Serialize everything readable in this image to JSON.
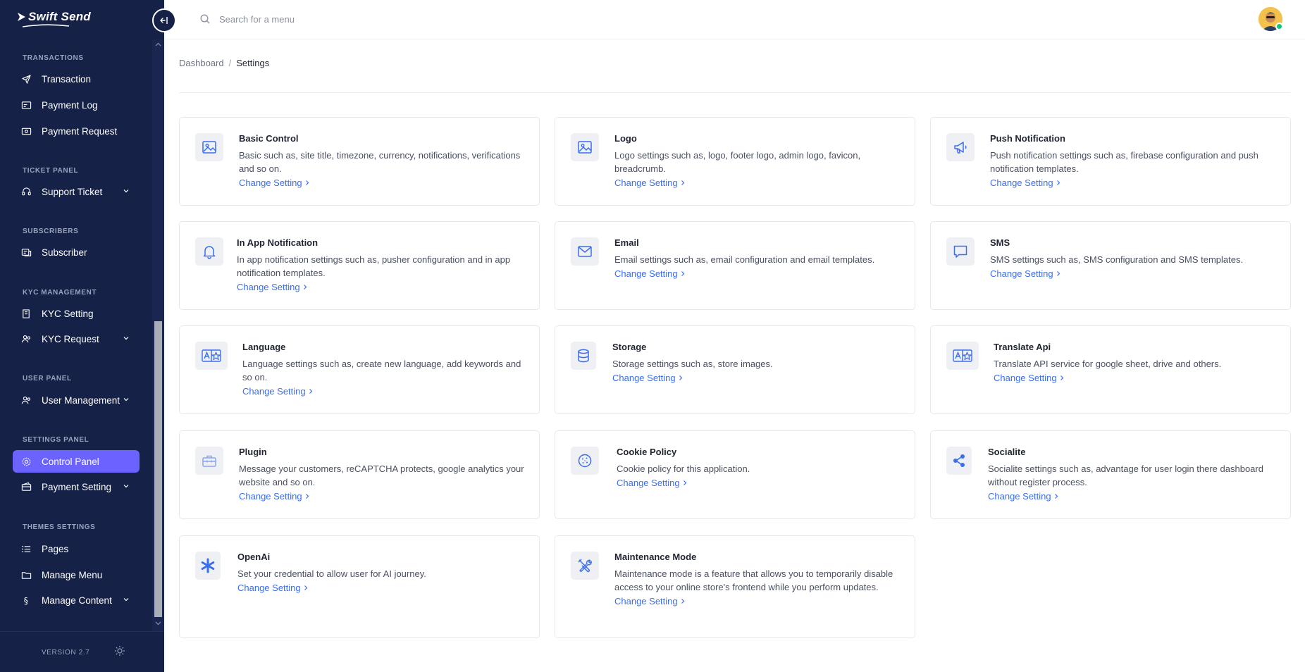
{
  "app": {
    "brand": "Swift Send",
    "version": "VERSION 2.7"
  },
  "search": {
    "placeholder": "Search for a menu"
  },
  "breadcrumb": {
    "root": "Dashboard",
    "separator": "/",
    "current": "Settings"
  },
  "sidebar": {
    "sections": [
      {
        "title": "TRANSACTIONS",
        "items": [
          {
            "label": "Transaction",
            "icon": "send-icon"
          },
          {
            "label": "Payment Log",
            "icon": "payment-log-icon"
          },
          {
            "label": "Payment Request",
            "icon": "cash-icon"
          }
        ]
      },
      {
        "title": "TICKET PANEL",
        "items": [
          {
            "label": "Support Ticket",
            "icon": "headset-icon",
            "expandable": true
          }
        ]
      },
      {
        "title": "SUBSCRIBERS",
        "items": [
          {
            "label": "Subscriber",
            "icon": "subscriber-icon"
          }
        ]
      },
      {
        "title": "KYC MANAGEMENT",
        "items": [
          {
            "label": "KYC Setting",
            "icon": "kyc-setting-icon"
          },
          {
            "label": "KYC Request",
            "icon": "users-icon",
            "expandable": true
          }
        ]
      },
      {
        "title": "USER PANEL",
        "items": [
          {
            "label": "User Management",
            "icon": "users-icon",
            "expandable": true
          }
        ]
      },
      {
        "title": "SETTINGS PANEL",
        "items": [
          {
            "label": "Control Panel",
            "icon": "gear-icon",
            "active": true
          },
          {
            "label": "Payment Setting",
            "icon": "payment-setting-icon",
            "expandable": true
          }
        ]
      },
      {
        "title": "THEMES SETTINGS",
        "items": [
          {
            "label": "Pages",
            "icon": "list-icon"
          },
          {
            "label": "Manage Menu",
            "icon": "folder-icon"
          },
          {
            "label": "Manage Content",
            "icon": "section-icon",
            "expandable": true
          }
        ]
      }
    ]
  },
  "cards": [
    {
      "title": "Basic Control",
      "desc": "Basic such as, site title, timezone, currency, notifications, verifications and so on.",
      "link": "Change Setting",
      "icon": "image-icon"
    },
    {
      "title": "Logo",
      "desc": "Logo settings such as, logo, footer logo, admin logo, favicon, breadcrumb.",
      "link": "Change Setting",
      "icon": "image-icon"
    },
    {
      "title": "Push Notification",
      "desc": "Push notification settings such as, firebase configuration and push notification templates.",
      "link": "Change Setting",
      "icon": "megaphone-icon"
    },
    {
      "title": "In App Notification",
      "desc": "In app notification settings such as, pusher configuration and in app notification templates.",
      "link": "Change Setting",
      "icon": "bell-icon"
    },
    {
      "title": "Email",
      "desc": "Email settings such as, email configuration and email templates.",
      "link": "Change Setting",
      "icon": "envelope-icon"
    },
    {
      "title": "SMS",
      "desc": "SMS settings such as, SMS configuration and SMS templates.",
      "link": "Change Setting",
      "icon": "chat-icon"
    },
    {
      "title": "Language",
      "desc": "Language settings such as, create new language, add keywords and so on.",
      "link": "Change Setting",
      "icon": "translate-icon"
    },
    {
      "title": "Storage",
      "desc": "Storage settings such as, store images.",
      "link": "Change Setting",
      "icon": "database-icon"
    },
    {
      "title": "Translate Api",
      "desc": "Translate API service for google sheet, drive and others.",
      "link": "Change Setting",
      "icon": "translate-icon"
    },
    {
      "title": "Plugin",
      "desc": "Message your customers, reCAPTCHA protects, google analytics your website and so on.",
      "link": "Change Setting",
      "icon": "toolbox-icon"
    },
    {
      "title": "Cookie Policy",
      "desc": "Cookie policy for this application.",
      "link": "Change Setting",
      "icon": "cookie-icon"
    },
    {
      "title": "Socialite",
      "desc": "Socialite settings such as, advantage for user login there dashboard without register process.",
      "link": "Change Setting",
      "icon": "share-icon"
    },
    {
      "title": "OpenAi",
      "desc": "Set your credential to allow user for AI journey.",
      "link": "Change Setting",
      "icon": "asterisk-icon"
    },
    {
      "title": "Maintenance Mode",
      "desc": "Maintenance mode is a feature that allows you to temporarily disable access to your online store's frontend while you perform updates.",
      "link": "Change Setting",
      "icon": "tools-icon"
    }
  ],
  "colors": {
    "sidebar": "#152147",
    "active": "#6c63ff",
    "link": "#3a6ef0",
    "online": "#18c07a"
  }
}
